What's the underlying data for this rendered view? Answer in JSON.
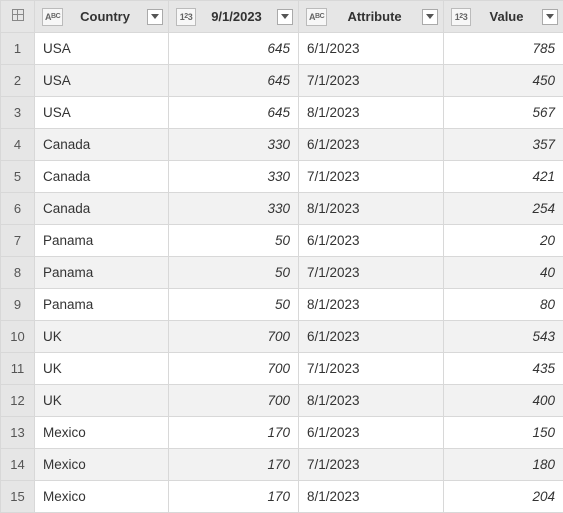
{
  "columns": [
    {
      "label": "Country",
      "type": "text"
    },
    {
      "label": "9/1/2023",
      "type": "number"
    },
    {
      "label": "Attribute",
      "type": "text"
    },
    {
      "label": "Value",
      "type": "number"
    }
  ],
  "type_icons": {
    "text": "AᴮC",
    "number": "1²3"
  },
  "rows": [
    {
      "idx": 1,
      "country": "USA",
      "sep": 645,
      "attr": "6/1/2023",
      "val": 785
    },
    {
      "idx": 2,
      "country": "USA",
      "sep": 645,
      "attr": "7/1/2023",
      "val": 450
    },
    {
      "idx": 3,
      "country": "USA",
      "sep": 645,
      "attr": "8/1/2023",
      "val": 567
    },
    {
      "idx": 4,
      "country": "Canada",
      "sep": 330,
      "attr": "6/1/2023",
      "val": 357
    },
    {
      "idx": 5,
      "country": "Canada",
      "sep": 330,
      "attr": "7/1/2023",
      "val": 421
    },
    {
      "idx": 6,
      "country": "Canada",
      "sep": 330,
      "attr": "8/1/2023",
      "val": 254
    },
    {
      "idx": 7,
      "country": "Panama",
      "sep": 50,
      "attr": "6/1/2023",
      "val": 20
    },
    {
      "idx": 8,
      "country": "Panama",
      "sep": 50,
      "attr": "7/1/2023",
      "val": 40
    },
    {
      "idx": 9,
      "country": "Panama",
      "sep": 50,
      "attr": "8/1/2023",
      "val": 80
    },
    {
      "idx": 10,
      "country": "UK",
      "sep": 700,
      "attr": "6/1/2023",
      "val": 543
    },
    {
      "idx": 11,
      "country": "UK",
      "sep": 700,
      "attr": "7/1/2023",
      "val": 435
    },
    {
      "idx": 12,
      "country": "UK",
      "sep": 700,
      "attr": "8/1/2023",
      "val": 400
    },
    {
      "idx": 13,
      "country": "Mexico",
      "sep": 170,
      "attr": "6/1/2023",
      "val": 150
    },
    {
      "idx": 14,
      "country": "Mexico",
      "sep": 170,
      "attr": "7/1/2023",
      "val": 180
    },
    {
      "idx": 15,
      "country": "Mexico",
      "sep": 170,
      "attr": "8/1/2023",
      "val": 204
    }
  ]
}
